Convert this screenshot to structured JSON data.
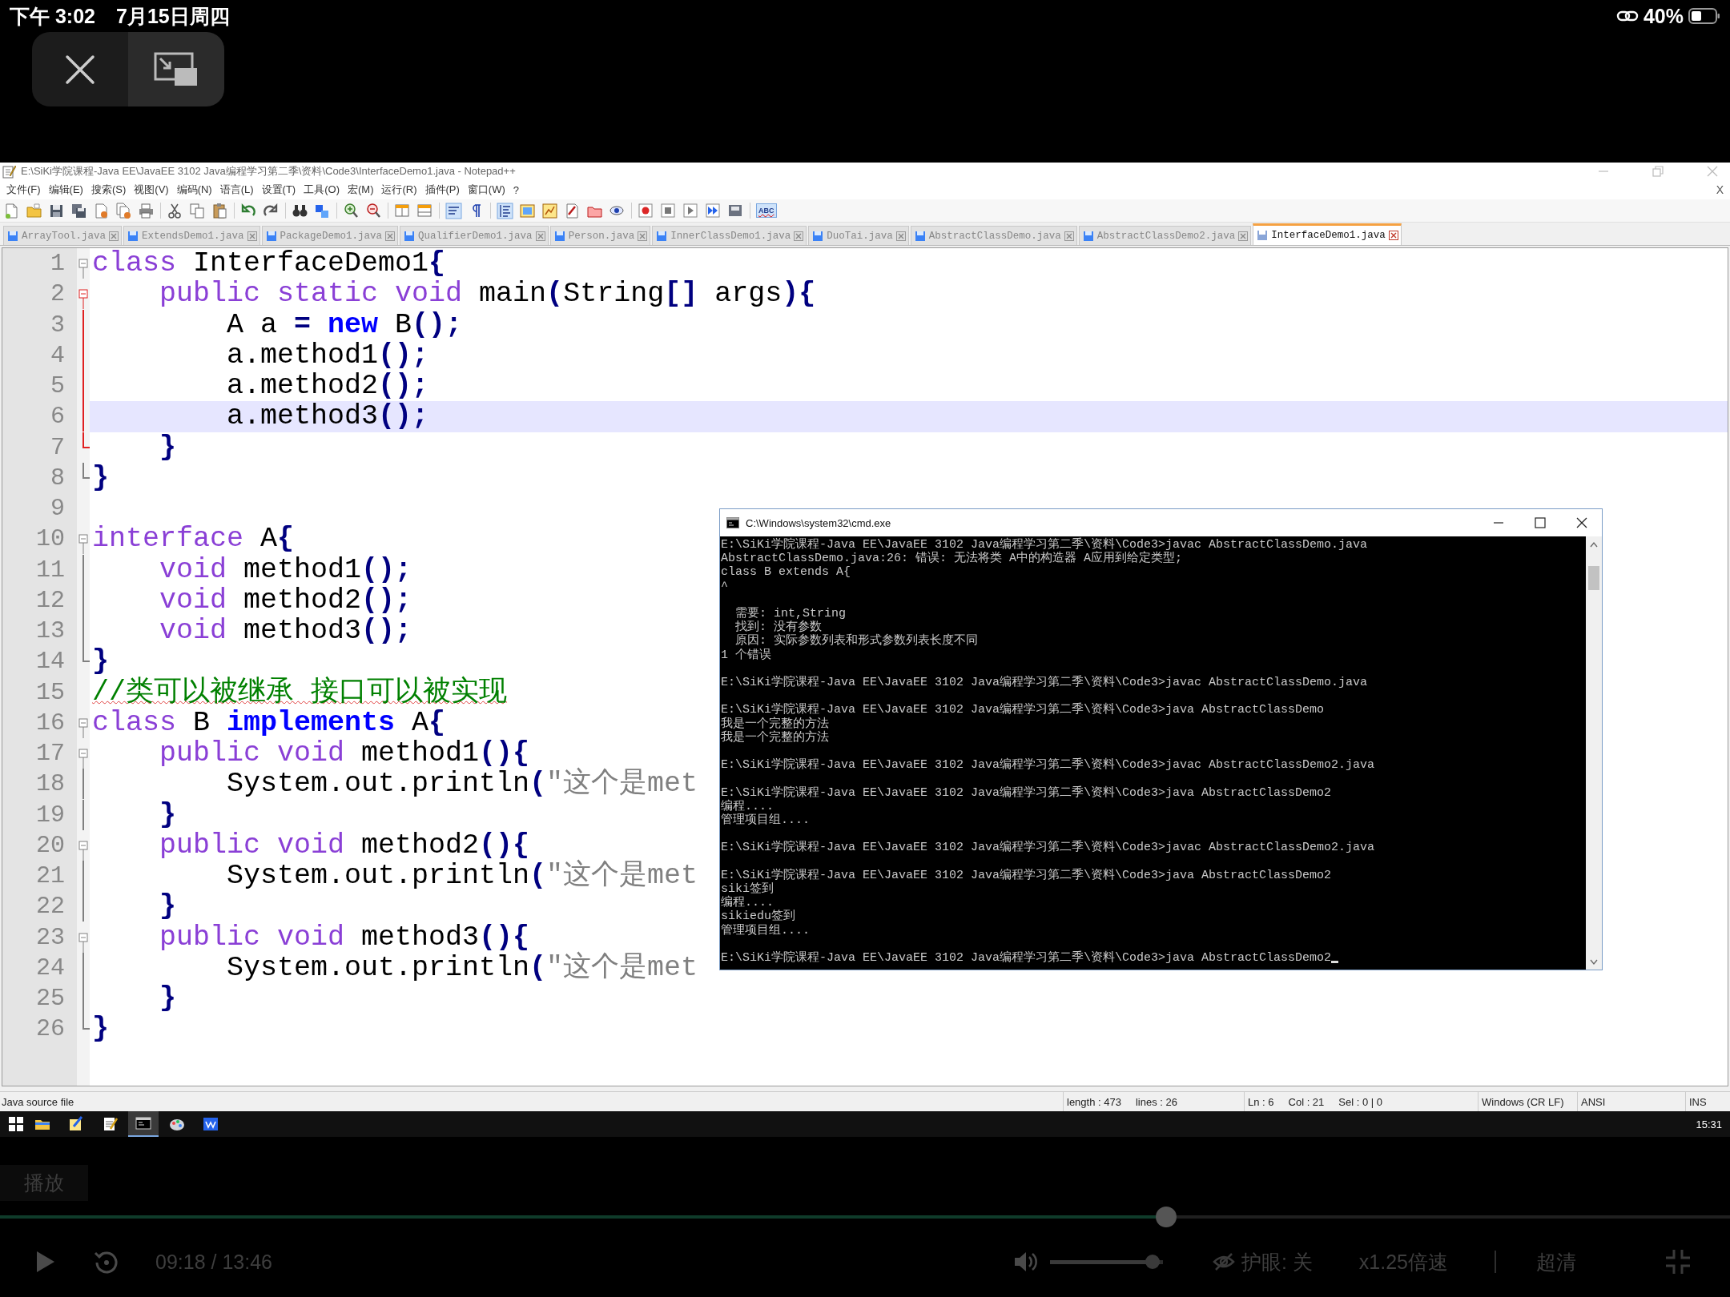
{
  "ipad_status": {
    "time": "下午 3:02",
    "date": "7月15日周四",
    "battery": "40%"
  },
  "notepad": {
    "title": "E:\\SiKi学院课程-Java EE\\JavaEE 3102 Java编程学习第二季\\资料\\Code3\\InterfaceDemo1.java - Notepad++",
    "menu": [
      "文件(F)",
      "编辑(E)",
      "搜索(S)",
      "视图(V)",
      "编码(N)",
      "语言(L)",
      "设置(T)",
      "工具(O)",
      "宏(M)",
      "运行(R)",
      "插件(P)",
      "窗口(W)",
      "?"
    ],
    "close_document": "X",
    "spellcheck_label": "ABC",
    "tabs": [
      {
        "label": "ArrayTool.java",
        "selected": false
      },
      {
        "label": "ExtendsDemo1.java",
        "selected": false
      },
      {
        "label": "PackageDemo1.java",
        "selected": false
      },
      {
        "label": "QualifierDemo1.java",
        "selected": false
      },
      {
        "label": "Person.java",
        "selected": false
      },
      {
        "label": "InnerClassDemo1.java",
        "selected": false
      },
      {
        "label": "DuoTai.java",
        "selected": false
      },
      {
        "label": "AbstractClassDemo.java",
        "selected": false
      },
      {
        "label": "AbstractClassDemo2.java",
        "selected": false
      },
      {
        "label": "InterfaceDemo1.java",
        "selected": true
      }
    ],
    "lines": [
      {
        "number": "1",
        "current": false,
        "kind": "fold-open",
        "in_current_block": false,
        "tokens": [
          {
            "kind": "keyword",
            "text": "class"
          },
          {
            "kind": "plain",
            "text": " InterfaceDemo1"
          },
          {
            "kind": "operator",
            "text": "{"
          }
        ]
      },
      {
        "number": "2",
        "current": false,
        "kind": "fold-open",
        "in_current_block": true,
        "tokens": [
          {
            "kind": "keyword",
            "text": "    public static void"
          },
          {
            "kind": "plain",
            "text": " main"
          },
          {
            "kind": "operator",
            "text": "("
          },
          {
            "kind": "plain",
            "text": "String"
          },
          {
            "kind": "operator",
            "text": "[]"
          },
          {
            "kind": "plain",
            "text": " args"
          },
          {
            "kind": "operator",
            "text": "){"
          }
        ]
      },
      {
        "number": "3",
        "current": false,
        "kind": "fold-body",
        "in_current_block": true,
        "tokens": [
          {
            "kind": "plain",
            "text": "        A a "
          },
          {
            "kind": "operator",
            "text": "="
          },
          {
            "kind": "reserved",
            "text": " new"
          },
          {
            "kind": "plain",
            "text": " B"
          },
          {
            "kind": "operator",
            "text": "();"
          }
        ]
      },
      {
        "number": "4",
        "current": false,
        "kind": "fold-body",
        "in_current_block": true,
        "tokens": [
          {
            "kind": "plain",
            "text": "        a.method1"
          },
          {
            "kind": "operator",
            "text": "();"
          }
        ]
      },
      {
        "number": "5",
        "current": false,
        "kind": "fold-body",
        "in_current_block": true,
        "tokens": [
          {
            "kind": "plain",
            "text": "        a.method2"
          },
          {
            "kind": "operator",
            "text": "();"
          }
        ]
      },
      {
        "number": "6",
        "current": true,
        "kind": "fold-body",
        "in_current_block": true,
        "tokens": [
          {
            "kind": "plain",
            "text": "        a.method3"
          },
          {
            "kind": "operator",
            "text": "();"
          }
        ]
      },
      {
        "number": "7",
        "current": false,
        "kind": "fold-end",
        "in_current_block": true,
        "tokens": [
          {
            "kind": "operator",
            "text": "    }"
          }
        ]
      },
      {
        "number": "8",
        "current": false,
        "kind": "fold-end",
        "in_current_block": false,
        "tokens": [
          {
            "kind": "operator",
            "text": "}"
          }
        ]
      },
      {
        "number": "9",
        "current": false,
        "kind": "plain"
      },
      {
        "number": "10",
        "current": false,
        "kind": "fold-open",
        "in_current_block": false,
        "tokens": [
          {
            "kind": "keyword",
            "text": "interface"
          },
          {
            "kind": "plain",
            "text": " A"
          },
          {
            "kind": "operator",
            "text": "{"
          }
        ]
      },
      {
        "number": "11",
        "current": false,
        "kind": "fold-body",
        "in_current_block": false,
        "tokens": [
          {
            "kind": "keyword",
            "text": "    void"
          },
          {
            "kind": "plain",
            "text": " method1"
          },
          {
            "kind": "operator",
            "text": "();"
          }
        ]
      },
      {
        "number": "12",
        "current": false,
        "kind": "fold-body",
        "in_current_block": false,
        "tokens": [
          {
            "kind": "keyword",
            "text": "    void"
          },
          {
            "kind": "plain",
            "text": " method2"
          },
          {
            "kind": "operator",
            "text": "();"
          }
        ]
      },
      {
        "number": "13",
        "current": false,
        "kind": "fold-body",
        "in_current_block": false,
        "tokens": [
          {
            "kind": "keyword",
            "text": "    void"
          },
          {
            "kind": "plain",
            "text": " method3"
          },
          {
            "kind": "operator",
            "text": "();"
          }
        ]
      },
      {
        "number": "14",
        "current": false,
        "kind": "fold-end",
        "in_current_block": false,
        "tokens": [
          {
            "kind": "operator",
            "text": "}"
          }
        ]
      },
      {
        "number": "15",
        "current": false,
        "kind": "plain",
        "tokens": [
          {
            "kind": "comment",
            "text": "//类可以被继承 接口可以被实现"
          }
        ]
      },
      {
        "number": "16",
        "current": false,
        "kind": "fold-open",
        "in_current_block": false,
        "tokens": [
          {
            "kind": "keyword",
            "text": "class"
          },
          {
            "kind": "plain",
            "text": " B"
          },
          {
            "kind": "reserved",
            "text": " implements"
          },
          {
            "kind": "plain",
            "text": " A"
          },
          {
            "kind": "operator",
            "text": "{"
          }
        ]
      },
      {
        "number": "17",
        "current": false,
        "kind": "fold-open",
        "in_current_block": false,
        "tokens": [
          {
            "kind": "keyword",
            "text": "    public void"
          },
          {
            "kind": "plain",
            "text": " method1"
          },
          {
            "kind": "operator",
            "text": "(){"
          }
        ]
      },
      {
        "number": "18",
        "current": false,
        "kind": "fold-body",
        "in_current_block": false,
        "tokens": [
          {
            "kind": "plain",
            "text": "        System.out.println"
          },
          {
            "kind": "operator",
            "text": "("
          },
          {
            "kind": "string",
            "text": "\"这个是met"
          }
        ]
      },
      {
        "number": "19",
        "current": false,
        "kind": "fold-body",
        "in_current_block": false,
        "tokens": [
          {
            "kind": "operator",
            "text": "    }"
          }
        ]
      },
      {
        "number": "20",
        "current": false,
        "kind": "fold-open",
        "in_current_block": false,
        "tokens": [
          {
            "kind": "keyword",
            "text": "    public void"
          },
          {
            "kind": "plain",
            "text": " method2"
          },
          {
            "kind": "operator",
            "text": "(){"
          }
        ]
      },
      {
        "number": "21",
        "current": false,
        "kind": "fold-body",
        "in_current_block": false,
        "tokens": [
          {
            "kind": "plain",
            "text": "        System.out.println"
          },
          {
            "kind": "operator",
            "text": "("
          },
          {
            "kind": "string",
            "text": "\"这个是met"
          }
        ]
      },
      {
        "number": "22",
        "current": false,
        "kind": "fold-body",
        "in_current_block": false,
        "tokens": [
          {
            "kind": "operator",
            "text": "    }"
          }
        ]
      },
      {
        "number": "23",
        "current": false,
        "kind": "fold-open",
        "in_current_block": false,
        "tokens": [
          {
            "kind": "keyword",
            "text": "    public void"
          },
          {
            "kind": "plain",
            "text": " method3"
          },
          {
            "kind": "operator",
            "text": "(){"
          }
        ]
      },
      {
        "number": "24",
        "current": false,
        "kind": "fold-body",
        "in_current_block": false,
        "tokens": [
          {
            "kind": "plain",
            "text": "        System.out.println"
          },
          {
            "kind": "operator",
            "text": "("
          },
          {
            "kind": "string",
            "text": "\"这个是met"
          }
        ]
      },
      {
        "number": "25",
        "current": false,
        "kind": "fold-body",
        "in_current_block": false,
        "tokens": [
          {
            "kind": "operator",
            "text": "    }"
          }
        ]
      },
      {
        "number": "26",
        "current": false,
        "kind": "fold-end",
        "in_current_block": false,
        "tokens": [
          {
            "kind": "operator",
            "text": "}"
          }
        ]
      }
    ],
    "status_bar": {
      "file_type": "Java source file",
      "length": "length : 473",
      "line_count": "lines : 26",
      "ln": "Ln : 6",
      "col": "Col : 21",
      "sel": "Sel : 0 | 0",
      "eol": "Windows (CR LF)",
      "encoding": "ANSI",
      "mode": "INS"
    }
  },
  "cmd": {
    "title": "C:\\Windows\\system32\\cmd.exe",
    "cursor": true,
    "blocks": [
      [
        "E:\\SiKi学院课程-Java EE\\JavaEE 3102 Java编程学习第二季\\资料\\Code3>javac AbstractClassDemo.java",
        "AbstractClassDemo.java:26: 错误: 无法将类 A中的构造器 A应用到给定类型;",
        "class B extends A{",
        "^"
      ],
      [
        "  需要: int,String",
        "  找到: 没有参数",
        "  原因: 实际参数列表和形式参数列表长度不同",
        "1 个错误"
      ],
      [
        "E:\\SiKi学院课程-Java EE\\JavaEE 3102 Java编程学习第二季\\资料\\Code3>javac AbstractClassDemo.java"
      ],
      [
        "E:\\SiKi学院课程-Java EE\\JavaEE 3102 Java编程学习第二季\\资料\\Code3>java AbstractClassDemo",
        "我是一个完整的方法",
        "我是一个完整的方法"
      ],
      [
        "E:\\SiKi学院课程-Java EE\\JavaEE 3102 Java编程学习第二季\\资料\\Code3>javac AbstractClassDemo2.java"
      ],
      [
        "E:\\SiKi学院课程-Java EE\\JavaEE 3102 Java编程学习第二季\\资料\\Code3>java AbstractClassDemo2",
        "编程....",
        "管理项目组...."
      ],
      [
        "E:\\SiKi学院课程-Java EE\\JavaEE 3102 Java编程学习第二季\\资料\\Code3>javac AbstractClassDemo2.java"
      ],
      [
        "E:\\SiKi学院课程-Java EE\\JavaEE 3102 Java编程学习第二季\\资料\\Code3>java AbstractClassDemo2",
        "siki签到",
        "编程....",
        "sikiedu签到",
        "管理项目组...."
      ],
      [
        "E:\\SiKi学院课程-Java EE\\JavaEE 3102 Java编程学习第二季\\资料\\Code3>java AbstractClassDemo2"
      ]
    ]
  },
  "taskbar": {
    "clock": "15:31",
    "apps": [
      {
        "kind": "explorer",
        "selected": false
      },
      {
        "kind": "paint",
        "selected": false
      },
      {
        "kind": "notepad",
        "selected": false
      },
      {
        "kind": "console",
        "selected": true
      },
      {
        "kind": "palette",
        "selected": false
      },
      {
        "kind": "window",
        "selected": false
      }
    ]
  },
  "player": {
    "play_label": "播放",
    "progress": {
      "level": 0.676
    },
    "time": "09:18 / 13:46",
    "volume": {
      "level": 0.97
    },
    "eye_care": "护眼: 关",
    "speed": "x1.25倍速",
    "quality": "超清"
  }
}
